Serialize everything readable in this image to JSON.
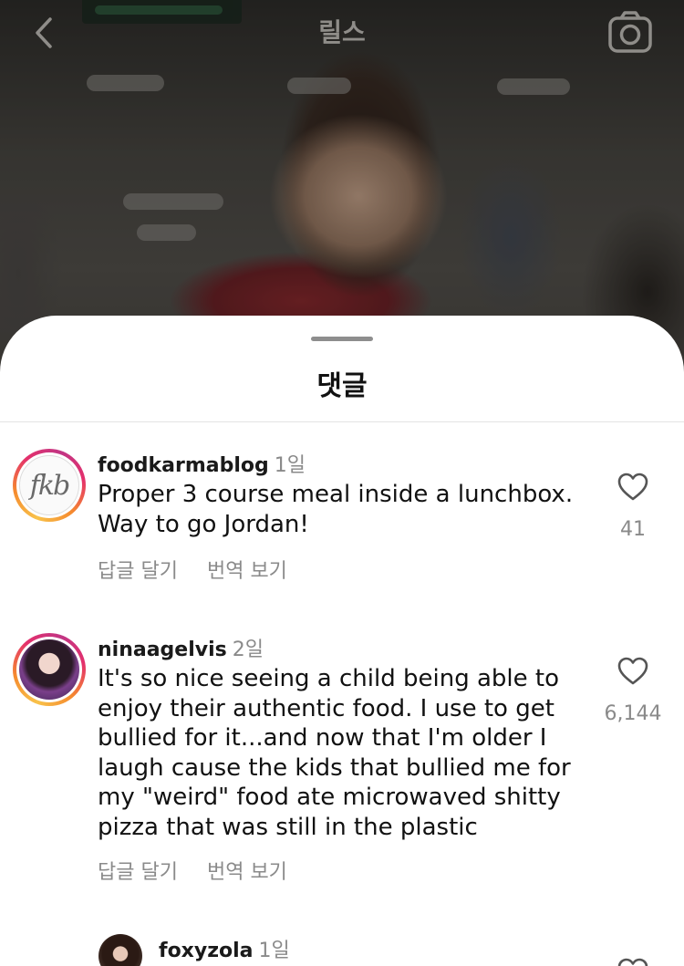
{
  "header": {
    "title": "릴스"
  },
  "sheet": {
    "title": "댓글"
  },
  "comments": [
    {
      "username": "foodkarmablog",
      "time": "1일",
      "text": "Proper 3 course meal inside a lunchbox. Way to go Jordan!",
      "likes": "41",
      "reply_label": "답글 달기",
      "translate_label": "번역 보기",
      "avatar_text": "fkb"
    },
    {
      "username": "ninaagelvis",
      "time": "2일",
      "text": "It's so nice seeing a child being able to enjoy their authentic food. I use to get bullied for it...and now that I'm older I laugh cause the kids that bullied me for my \"weird\" food ate microwaved shitty pizza that was still in the plastic",
      "likes": "6,144",
      "reply_label": "답글 달기",
      "translate_label": "번역 보기"
    },
    {
      "username": "foxyzola",
      "time": "1일"
    }
  ],
  "icons": {
    "back": "chevron-left-icon",
    "camera": "camera-icon",
    "like": "heart-outline-icon"
  },
  "colors": {
    "sheet_bg": "#ffffff",
    "secondary_text": "#8a8a8a",
    "story_ring_start": "#f8c24a",
    "story_ring_end": "#c13584"
  }
}
